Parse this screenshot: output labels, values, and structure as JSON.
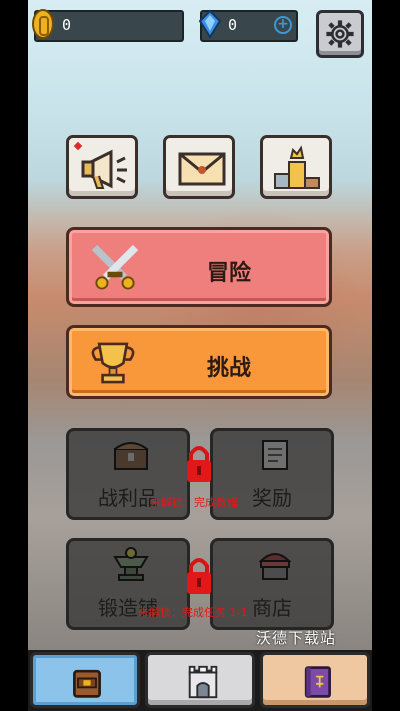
{
  "resources": {
    "coins": {
      "value": "0",
      "icon": "gold-coin-icon"
    },
    "gems": {
      "value": "0",
      "icon": "blue-gem-icon",
      "add_icon": "plus-icon"
    }
  },
  "settings": {
    "icon": "gear-icon"
  },
  "quick_buttons": [
    {
      "name": "announcement",
      "icon": "megaphone-icon",
      "has_notification": true
    },
    {
      "name": "mail",
      "icon": "envelope-icon",
      "has_notification": false
    },
    {
      "name": "ranking",
      "icon": "podium-icon",
      "has_notification": false
    }
  ],
  "main_buttons": {
    "adventure": {
      "label": "冒险",
      "icon": "crossed-swords-icon",
      "color": "#ee7f7c"
    },
    "challenge": {
      "label": "挑战",
      "icon": "trophy-icon",
      "color": "#f8983a"
    }
  },
  "locked_features": [
    {
      "label": "战利品",
      "icon": "treasure-chest-icon"
    },
    {
      "label": "奖励",
      "icon": "scroll-icon"
    },
    {
      "label": "锻造铺",
      "icon": "anvil-icon"
    },
    {
      "label": "商店",
      "icon": "shop-awning-icon"
    }
  ],
  "unlock_hints": {
    "row1": "未解锁：完成教程",
    "row2": "未解锁：完成任务 1-1"
  },
  "watermark": "沃德下载站",
  "bottom_tabs": [
    {
      "name": "inventory",
      "icon": "backpack-icon",
      "active": true
    },
    {
      "name": "castle",
      "icon": "castle-icon",
      "active": false
    },
    {
      "name": "codex",
      "icon": "spellbook-icon",
      "active": false
    }
  ]
}
